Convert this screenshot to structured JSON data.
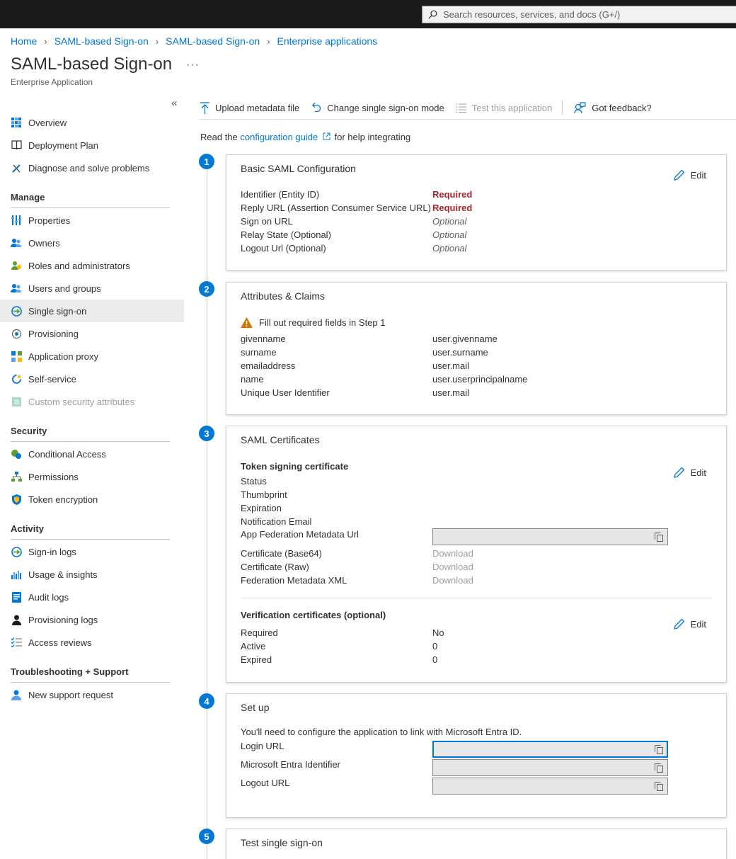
{
  "search": {
    "placeholder": "Search resources, services, and docs (G+/)"
  },
  "breadcrumb": [
    "Home",
    "SAML-based Sign-on",
    "SAML-based Sign-on",
    "Enterprise applications"
  ],
  "header": {
    "title": "SAML-based Sign-on",
    "more": "···",
    "subtitle": "Enterprise Application"
  },
  "sidebar": {
    "collapse": "«",
    "top": [
      {
        "label": "Overview",
        "icon": "grid-icon"
      },
      {
        "label": "Deployment Plan",
        "icon": "book-icon"
      },
      {
        "label": "Diagnose and solve problems",
        "icon": "wrench-icon"
      }
    ],
    "manage_title": "Manage",
    "manage": [
      {
        "label": "Properties",
        "icon": "properties-icon"
      },
      {
        "label": "Owners",
        "icon": "owners-icon"
      },
      {
        "label": "Roles and administrators",
        "icon": "roles-icon"
      },
      {
        "label": "Users and groups",
        "icon": "users-icon"
      },
      {
        "label": "Single sign-on",
        "icon": "sso-icon"
      },
      {
        "label": "Provisioning",
        "icon": "provisioning-icon"
      },
      {
        "label": "Application proxy",
        "icon": "app-proxy-icon"
      },
      {
        "label": "Self-service",
        "icon": "self-service-icon"
      },
      {
        "label": "Custom security attributes",
        "icon": "custom-attributes-icon"
      }
    ],
    "security_title": "Security",
    "security": [
      {
        "label": "Conditional Access",
        "icon": "conditional-access-icon"
      },
      {
        "label": "Permissions",
        "icon": "permissions-icon"
      },
      {
        "label": "Token encryption",
        "icon": "shield-icon"
      }
    ],
    "activity_title": "Activity",
    "activity": [
      {
        "label": "Sign-in logs",
        "icon": "signin-logs-icon"
      },
      {
        "label": "Usage & insights",
        "icon": "chart-icon"
      },
      {
        "label": "Audit logs",
        "icon": "audit-logs-icon"
      },
      {
        "label": "Provisioning logs",
        "icon": "person-icon"
      },
      {
        "label": "Access reviews",
        "icon": "checklist-icon"
      }
    ],
    "support_title": "Troubleshooting + Support",
    "support": [
      {
        "label": "New support request",
        "icon": "support-icon"
      }
    ]
  },
  "toolbar": {
    "upload": "Upload metadata file",
    "change": "Change single sign-on mode",
    "test": "Test this application",
    "feedback": "Got feedback?"
  },
  "intro": {
    "before": "Read the ",
    "link": "configuration guide",
    "after": " for help integrating"
  },
  "steps": [
    "1",
    "2",
    "3",
    "4",
    "5"
  ],
  "card1": {
    "title": "Basic SAML Configuration",
    "edit": "Edit",
    "rows": [
      {
        "k": "Identifier (Entity ID)",
        "v": "Required"
      },
      {
        "k": "Reply URL (Assertion Consumer Service URL)",
        "v": "Required"
      },
      {
        "k": "Sign on URL",
        "v": "Optional"
      },
      {
        "k": "Relay State (Optional)",
        "v": "Optional"
      },
      {
        "k": "Logout Url (Optional)",
        "v": "Optional"
      }
    ]
  },
  "card2": {
    "title": "Attributes & Claims",
    "warning": "Fill out required fields in Step 1",
    "rows": [
      {
        "k": "givenname",
        "v": "user.givenname"
      },
      {
        "k": "surname",
        "v": "user.surname"
      },
      {
        "k": "emailaddress",
        "v": "user.mail"
      },
      {
        "k": "name",
        "v": "user.userprincipalname"
      },
      {
        "k": "Unique User Identifier",
        "v": "user.mail"
      }
    ]
  },
  "card3": {
    "title": "SAML Certificates",
    "token_title": "Token signing certificate",
    "edit": "Edit",
    "token_rows": [
      "Status",
      "Thumbprint",
      "Expiration",
      "Notification Email"
    ],
    "metadata_url_label": "App Federation Metadata Url",
    "downloads": [
      {
        "k": "Certificate (Base64)",
        "v": "Download"
      },
      {
        "k": "Certificate (Raw)",
        "v": "Download"
      },
      {
        "k": "Federation Metadata XML",
        "v": "Download"
      }
    ],
    "verify_title": "Verification certificates (optional)",
    "verify_edit": "Edit",
    "verify_rows": [
      {
        "k": "Required",
        "v": "No"
      },
      {
        "k": "Active",
        "v": "0"
      },
      {
        "k": "Expired",
        "v": "0"
      }
    ]
  },
  "card4": {
    "title": "Set up",
    "text": "You'll need to configure the application to link with Microsoft Entra ID.",
    "fields": [
      "Login URL",
      "Microsoft Entra Identifier",
      "Logout URL"
    ]
  },
  "card5": {
    "title": "Test single sign-on"
  }
}
